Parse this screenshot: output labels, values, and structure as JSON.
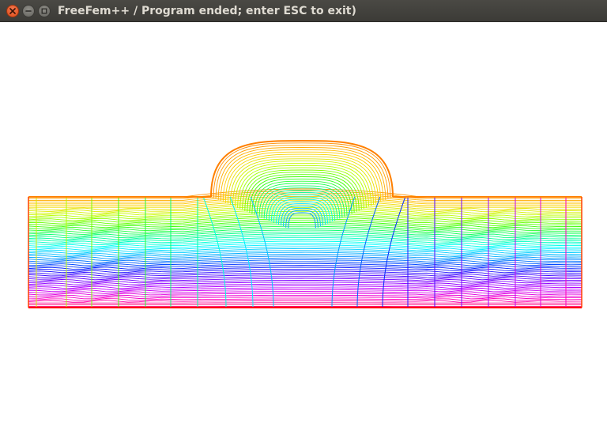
{
  "window": {
    "title": "FreeFem++ / Program ended; enter ESC to exit)",
    "controls": {
      "close": "close-icon",
      "minimize": "minimize-icon",
      "maximize": "maximize-icon"
    }
  },
  "plot": {
    "description_icon": "isoline-contour-plot",
    "background_color": "#ffffff",
    "colormap": [
      "#ff8000",
      "#ffd000",
      "#c0ff00",
      "#40ff00",
      "#00ff80",
      "#00ffff",
      "#00a0ff",
      "#0020ff",
      "#6000ff",
      "#c000ff",
      "#ff00c0",
      "#ff0040"
    ],
    "boundary_color": "#ff0000"
  }
}
